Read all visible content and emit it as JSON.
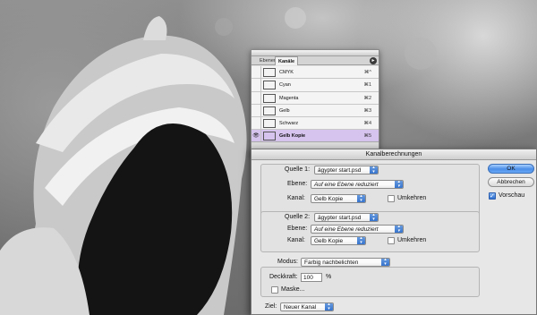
{
  "palette": {
    "tabs": [
      "Ebenen",
      "Kanäle"
    ],
    "menu_glyph": "▸",
    "channels": [
      {
        "name": "CMYK",
        "shortcut": "⌘^",
        "visible": false,
        "selected": false
      },
      {
        "name": "Cyan",
        "shortcut": "⌘1",
        "visible": false,
        "selected": false
      },
      {
        "name": "Magenta",
        "shortcut": "⌘2",
        "visible": false,
        "selected": false
      },
      {
        "name": "Gelb",
        "shortcut": "⌘3",
        "visible": false,
        "selected": false
      },
      {
        "name": "Schwarz",
        "shortcut": "⌘4",
        "visible": false,
        "selected": false
      },
      {
        "name": "Gelb Kopie",
        "shortcut": "⌘5",
        "visible": true,
        "selected": true
      }
    ],
    "eye_glyph": "👁",
    "selected_color": "#d6c3ee"
  },
  "dialog": {
    "title": "Kanalberechnungen",
    "source1": {
      "label": "Quelle 1:",
      "file": "ägypter start.psd",
      "layer_label": "Ebene:",
      "layer": "Auf eine Ebene reduziert",
      "channel_label": "Kanal:",
      "channel": "Gelb Kopie",
      "invert_label": "Umkehren",
      "invert": false
    },
    "source2": {
      "label": "Quelle 2:",
      "file": "ägypter start.psd",
      "layer_label": "Ebene:",
      "layer": "Auf eine Ebene reduziert",
      "channel_label": "Kanal:",
      "channel": "Gelb Kopie",
      "invert_label": "Umkehren",
      "invert": false
    },
    "mode_label": "Modus:",
    "mode": "Farbig nachbelichten",
    "opacity_label": "Deckkraft:",
    "opacity": "100",
    "opacity_unit": "%",
    "mask_label": "Maske...",
    "mask": false,
    "target_label": "Ziel:",
    "target": "Neuer Kanal",
    "ok_label": "OK",
    "cancel_label": "Abbrechen",
    "preview_label": "Vorschau",
    "preview": true,
    "accent_color": "#4a8ee8"
  }
}
